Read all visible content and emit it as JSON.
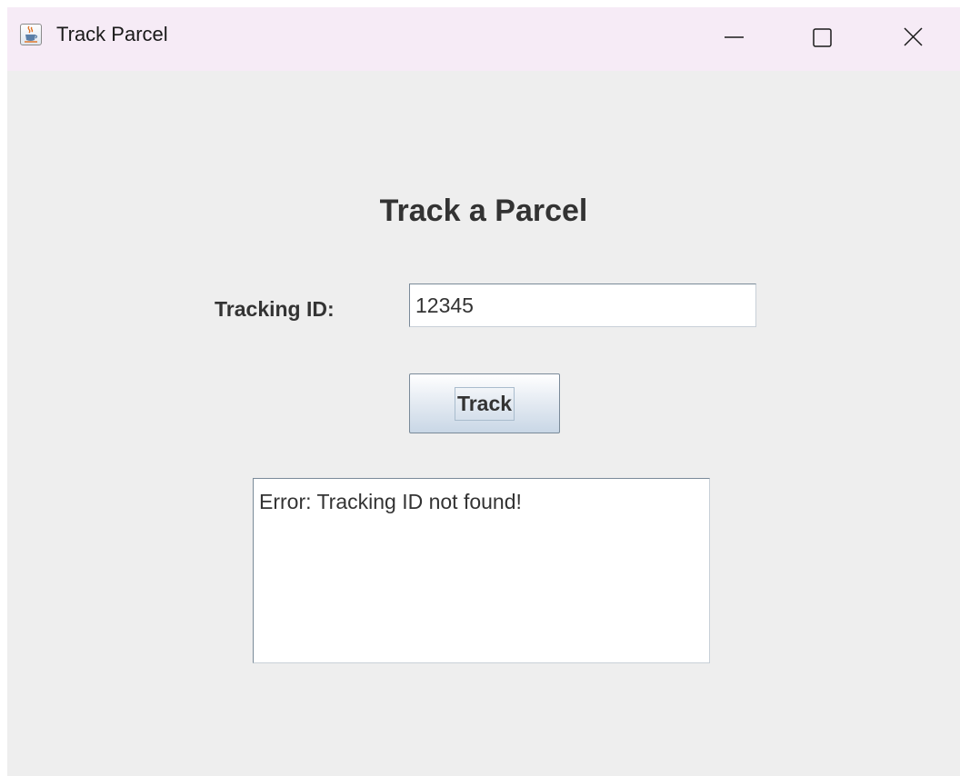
{
  "window": {
    "title": "Track Parcel",
    "icon": "java-cup-icon",
    "controls": [
      "minimize-icon",
      "maximize-icon",
      "close-icon"
    ]
  },
  "form": {
    "heading": "Track a Parcel",
    "tracking_label": "Tracking ID:",
    "tracking_value": "12345",
    "track_button_label": "Track",
    "result_text": "Error: Tracking ID not found!"
  },
  "colors": {
    "window_background": "#eeeeee",
    "titlebar_background": "#f6ebf6",
    "text": "#333333"
  }
}
